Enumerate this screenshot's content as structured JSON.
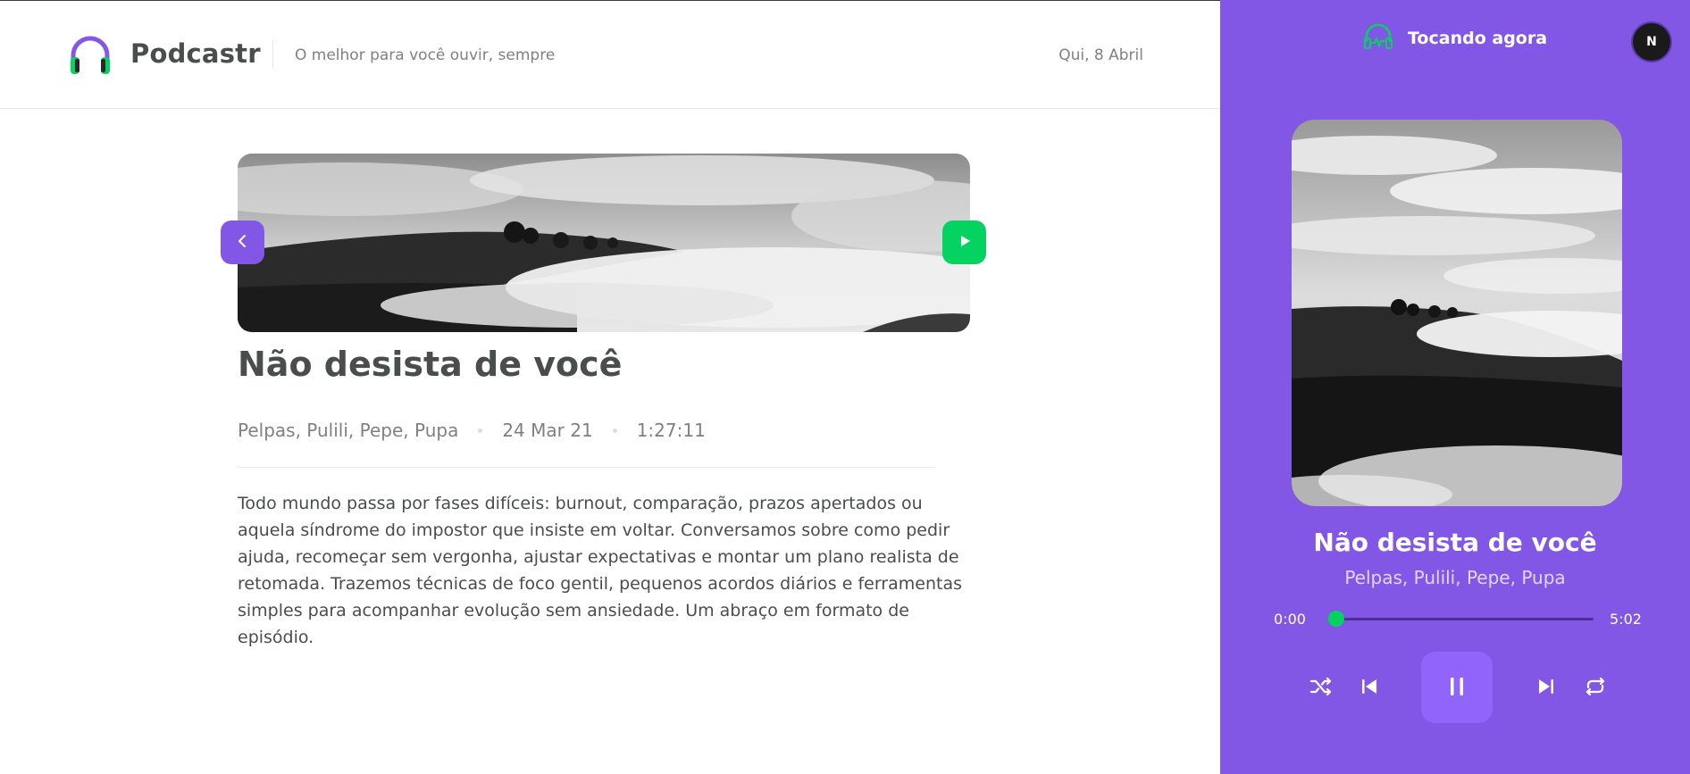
{
  "header": {
    "brand": "Podcastr",
    "tagline": "O melhor para você ouvir, sempre",
    "date": "Qui, 8 Abril"
  },
  "episode": {
    "title": "Não desista de você",
    "members": "Pelpas, Pulili, Pepe, Pupa",
    "published_at": "24 Mar 21",
    "duration": "1:27:11",
    "description": "Todo mundo passa por fases difíceis: burnout, comparação, prazos apertados ou aquela síndrome do impostor que insiste em voltar. Conversamos sobre como pedir ajuda, recomeçar sem vergonha, ajustar expectativas e montar um plano realista de retomada. Trazemos técnicas de foco gentil, pequenos acordos diários e ferramentas simples para acompanhar evolução sem ansiedade. Um abraço em formato de episódio."
  },
  "player": {
    "header_label": "Tocando agora",
    "avatar_initial": "N",
    "title": "Não desista de você",
    "members": "Pelpas, Pulili, Pepe, Pupa",
    "current_time": "0:00",
    "total_time": "5:02",
    "progress": 0.0
  },
  "icons": {
    "logo": "headphones-icon",
    "back": "chevron-left-icon",
    "play": "play-icon",
    "now_playing": "headphones-playing-icon",
    "shuffle": "shuffle-icon",
    "previous": "skip-previous-icon",
    "pause": "pause-icon",
    "next": "skip-next-icon",
    "repeat": "repeat-icon"
  },
  "colors": {
    "brand_purple": "#8257e5",
    "accent_green": "#04d361",
    "text_dark": "#494d4b",
    "text_muted": "#808080"
  }
}
